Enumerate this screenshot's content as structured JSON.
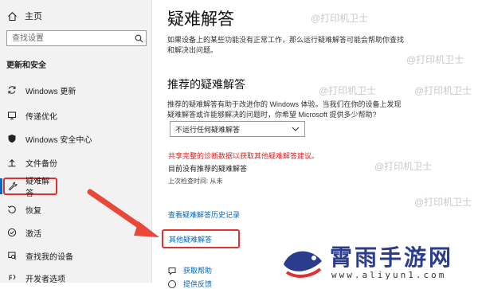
{
  "sidebar": {
    "home_label": "主页",
    "search_placeholder": "查找设置",
    "section_title": "更新和安全",
    "items": [
      {
        "label": "Windows 更新",
        "icon": "sync-icon"
      },
      {
        "label": "传递优化",
        "icon": "delivery-icon"
      },
      {
        "label": "Windows 安全中心",
        "icon": "shield-icon"
      },
      {
        "label": "文件备份",
        "icon": "backup-icon"
      },
      {
        "label": "疑难解答",
        "icon": "wrench-icon",
        "active": true
      },
      {
        "label": "恢复",
        "icon": "recovery-icon"
      },
      {
        "label": "激活",
        "icon": "activation-icon"
      },
      {
        "label": "查找我的设备",
        "icon": "find-device-icon"
      },
      {
        "label": "开发者选项",
        "icon": "developer-icon"
      }
    ]
  },
  "main": {
    "title": "疑难解答",
    "description": "如果设备上的某些功能没有正常工作，那么运行疑难解答可能会帮助你查找和解决出问题。",
    "recommended_heading": "推荐的疑难解答",
    "recommended_desc": "推荐的疑难解答有助于改进你的 Windows 体验。当我们在你的设备上发现疑难解答或许能够解决的问题时，你希望 Microsoft 提供多少帮助?",
    "select_value": "不运行任何疑难解答",
    "red_note": "共享完整的诊断数据以获取其他疑难解答建议。",
    "no_recommendation": "目前没有推荐的疑难解答",
    "last_check": "上次检查时间: 从未",
    "history_link": "查看疑难解答历史记录",
    "other_link": "其他疑难解答",
    "help_links": [
      {
        "label": "获取帮助",
        "icon": "help-icon"
      },
      {
        "label": "提供反馈",
        "icon": "feedback-icon"
      }
    ]
  },
  "watermarks": {
    "printer_guard": "@打印机卫士",
    "logo_text": "霄雨手游网",
    "logo_url": "www.aliyun1.com"
  },
  "colors": {
    "accent": "#0067c0",
    "highlight": "#e03030",
    "logo": "#2b3c8f"
  }
}
